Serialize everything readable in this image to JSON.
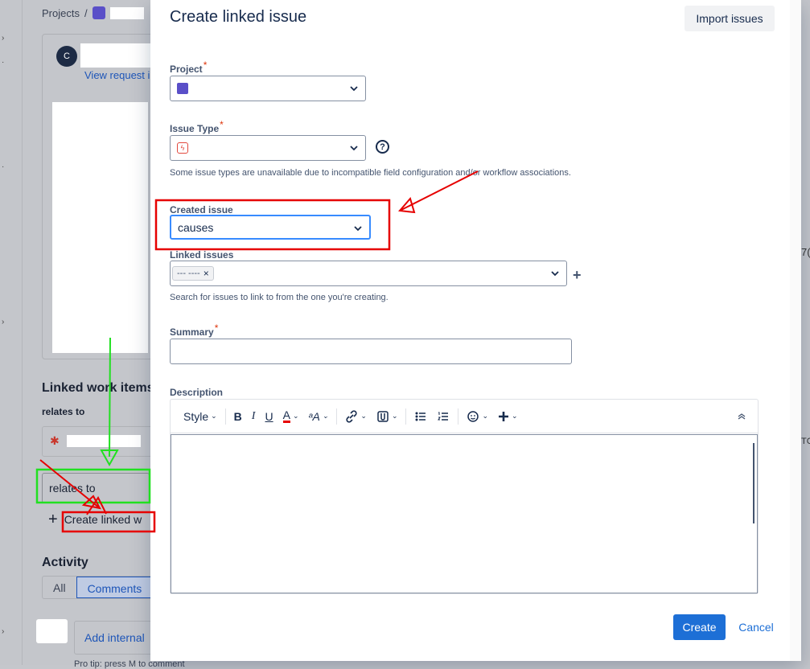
{
  "background": {
    "breadcrumb": "Projects",
    "breadcrumb_sep": "/",
    "avatar_initial": "C",
    "view_request_link": "View request ir",
    "linked_heading": "Linked work items",
    "relates_group": "relates to",
    "relates_select_value": "relates to",
    "create_linked_link": "Create linked w",
    "activity_heading": "Activity",
    "activity_tabs": [
      "All",
      "Comments"
    ],
    "add_internal": "Add internal",
    "pro_tip": "Pro tip: press M to comment",
    "right_fragment_1": "7(",
    "right_fragment_2": "TC"
  },
  "modal": {
    "title": "Create linked issue",
    "import_button": "Import issues",
    "project_label": "Project",
    "project_value": "",
    "issue_type_label": "Issue Type",
    "issue_type_value": "",
    "issue_type_helper": "Some issue types are unavailable due to incompatible field configuration and/or workflow associations.",
    "created_issue_label": "Created issue",
    "created_issue_value": "causes",
    "linked_issues_label": "Linked issues",
    "linked_issue_tag": "---  ----",
    "linked_issues_helper": "Search for issues to link to from the one you're creating.",
    "summary_label": "Summary",
    "description_label": "Description",
    "toolbar": {
      "style": "Style",
      "bold": "B",
      "italic": "I",
      "underline": "U",
      "text_color": "A",
      "more_format": "ᵃA"
    },
    "create_button": "Create",
    "cancel_button": "Cancel"
  },
  "colors": {
    "primary": "#1d6fd6",
    "required": "#de350b",
    "annotation_red": "#e60000",
    "annotation_green": "#21e021"
  }
}
